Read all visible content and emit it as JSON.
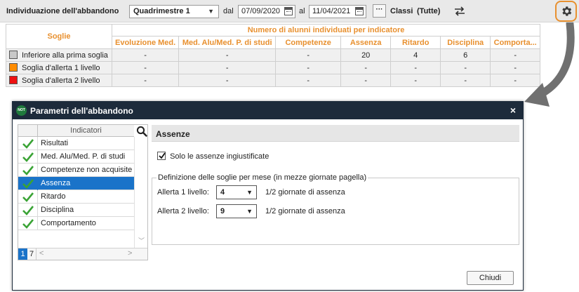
{
  "toolbar": {
    "label": "Individuazione dell'abbandono",
    "period": "Quadrimestre 1",
    "dal_label": "dal",
    "date_from": "07/09/2020",
    "al_label": "al",
    "date_to": "11/04/2021",
    "more_label": "···",
    "classes_label": "Classi",
    "classes_value": "(Tutte)",
    "swap_icon": "swap-arrows-icon",
    "settings_icon": "gear-icon",
    "highlight_color": "#e8902f"
  },
  "summary": {
    "soglie_header": "Soglie",
    "group_header": "Numero di alunni individuati per indicatore",
    "columns": [
      "Evoluzione Med.",
      "Med. Alu/Med. P. di studi",
      "Competenze",
      "Assenza",
      "Ritardo",
      "Disciplina",
      "Comporta..."
    ],
    "rows": [
      {
        "label": "Inferiore alla prima soglia",
        "color": "#c8c8c8",
        "values": [
          "-",
          "-",
          "-",
          "20",
          "4",
          "6",
          "-"
        ]
      },
      {
        "label": "Soglia d'allerta 1 livello",
        "color": "#ff8c00",
        "values": [
          "-",
          "-",
          "-",
          "-",
          "-",
          "-",
          "-"
        ]
      },
      {
        "label": "Soglia d'allerta 2 livello",
        "color": "#ee1111",
        "values": [
          "-",
          "-",
          "-",
          "-",
          "-",
          "-",
          "-"
        ]
      }
    ]
  },
  "dialog": {
    "logo_text": "NOT",
    "title": "Parametri dell'abbandono",
    "close_symbol": "×",
    "list_header": "Indicatori",
    "items": [
      {
        "label": "Risultati",
        "checked": true,
        "selected": false
      },
      {
        "label": "Med. Alu/Med. P. di studi",
        "checked": true,
        "selected": false
      },
      {
        "label": "Competenze non acquisite",
        "checked": true,
        "selected": false
      },
      {
        "label": "Assenza",
        "checked": true,
        "selected": true
      },
      {
        "label": "Ritardo",
        "checked": true,
        "selected": false
      },
      {
        "label": "Disciplina",
        "checked": true,
        "selected": false
      },
      {
        "label": "Comportamento",
        "checked": true,
        "selected": false
      }
    ],
    "pagination": {
      "current": "1",
      "total": "7"
    },
    "detail_title": "Assenze",
    "checkbox_label": "Solo le assenze ingiustificate",
    "checkbox_checked": true,
    "fieldset_legend": "Definizione delle soglie per mese (in mezze giornate pagella)",
    "alert1_label": "Allerta 1 livello:",
    "alert1_value": "4",
    "alert2_label": "Allerta 2 livello:",
    "alert2_value": "9",
    "unit_label": "1/2 giornate di assenza",
    "close_button": "Chiudi",
    "selection_color": "#1a73c9",
    "check_color": "#3aa335",
    "title_bar_color": "#1d2b3b"
  }
}
